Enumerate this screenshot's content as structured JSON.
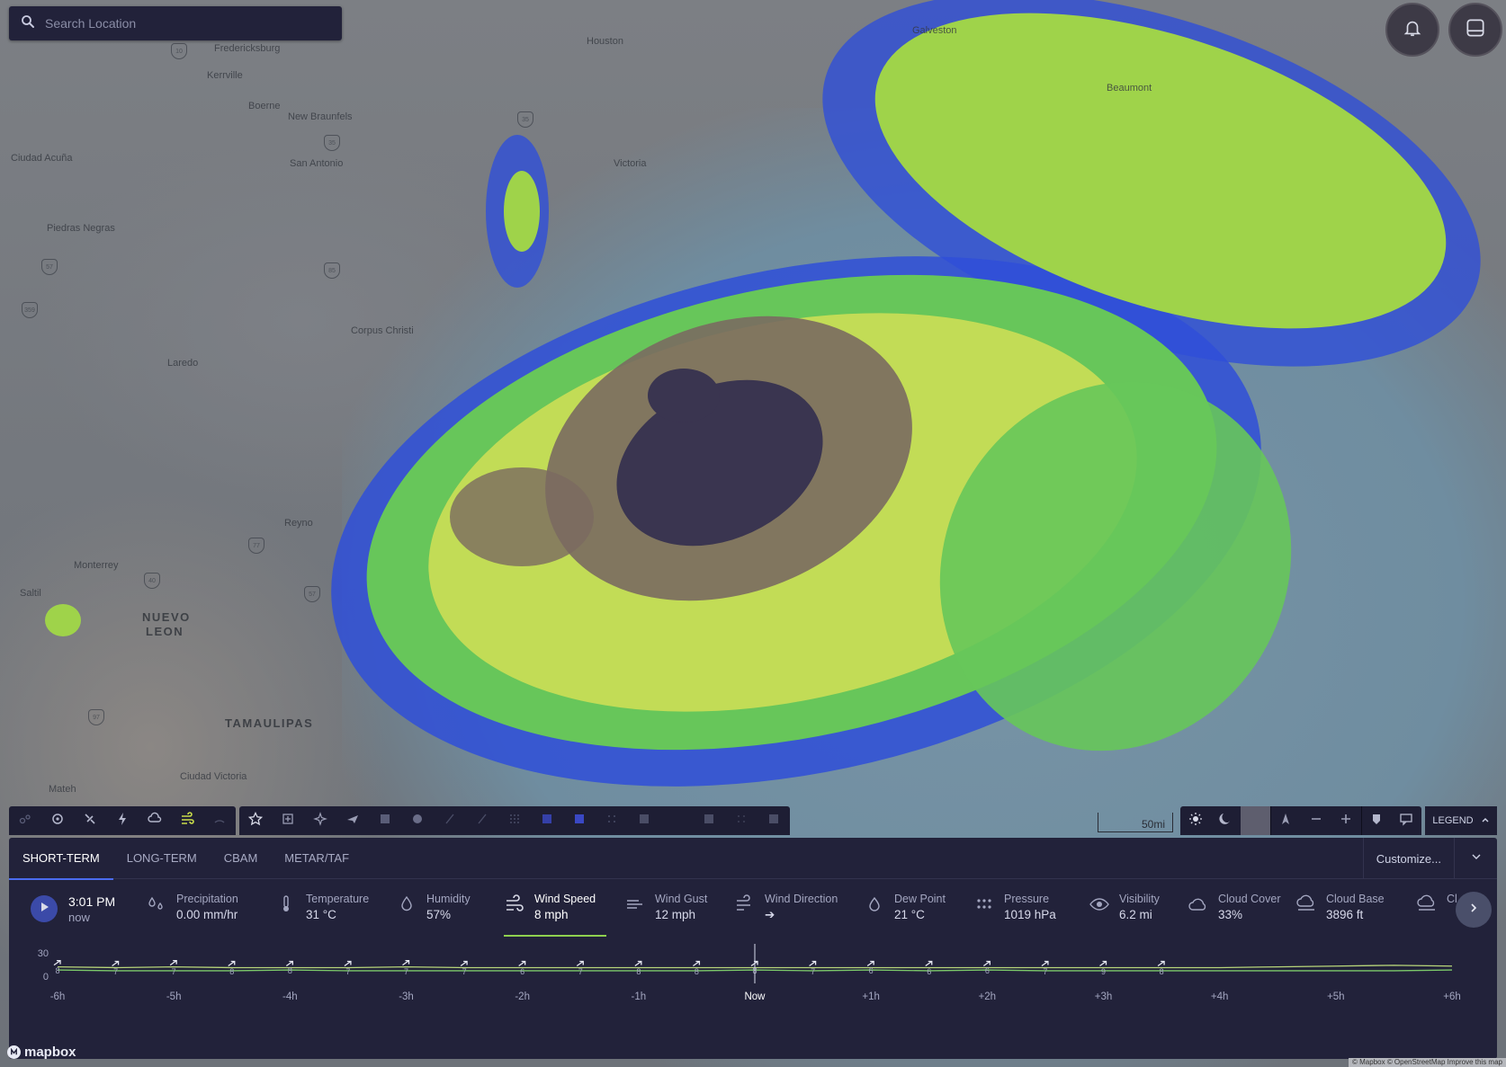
{
  "search": {
    "placeholder": "Search Location"
  },
  "map": {
    "labels": {
      "fredericksburg": "Fredericksburg",
      "kerrville": "Kerrville",
      "boerne": "Boerne",
      "new_braunfels": "New Braunfels",
      "san_antonio": "San Antonio",
      "ciudad_acuna": "Ciudad Acuña",
      "piedras_negras": "Piedras Negras",
      "laredo": "Laredo",
      "corpus_christi": "Corpus Christi",
      "reynosa": "Reyno",
      "monterrey": "Monterrey",
      "nuevo_leon_1": "NUEVO",
      "nuevo_leon_2": "LEON",
      "tamaulipas": "TAMAULIPAS",
      "ciudad_victoria": "Ciudad Victoria",
      "saltillo": "Saltil",
      "matehuala": "Mateh",
      "victoria_tx": "Victoria",
      "galveston": "Galveston",
      "beaumont": "Beaumont",
      "houston": "Houston"
    },
    "shields": [
      "10",
      "35",
      "35",
      "57",
      "359",
      "85",
      "40",
      "57",
      "97",
      "77"
    ],
    "scale_label": "50mi",
    "legend_label": "LEGEND",
    "attribution": "© Mapbox © OpenStreetMap  Improve this map",
    "logo_text": "mapbox"
  },
  "tabs": {
    "short_term": "SHORT-TERM",
    "long_term": "LONG-TERM",
    "cbam": "CBAM",
    "metar_taf": "METAR/TAF",
    "customize": "Customize..."
  },
  "current": {
    "time": "3:01 PM",
    "relative": "now"
  },
  "metrics": {
    "precipitation": {
      "label": "Precipitation",
      "value": "0.00 mm/hr"
    },
    "temperature": {
      "label": "Temperature",
      "value": "31 °C"
    },
    "humidity": {
      "label": "Humidity",
      "value": "57%"
    },
    "wind_speed": {
      "label": "Wind Speed",
      "value": "8 mph"
    },
    "wind_gust": {
      "label": "Wind Gust",
      "value": "12 mph"
    },
    "wind_direction": {
      "label": "Wind Direction",
      "value": "➔"
    },
    "dew_point": {
      "label": "Dew Point",
      "value": "21 °C"
    },
    "pressure": {
      "label": "Pressure",
      "value": "1019 hPa"
    },
    "visibility": {
      "label": "Visibility",
      "value": "6.2 mi"
    },
    "cloud_cover": {
      "label": "Cloud Cover",
      "value": "33%"
    },
    "cloud_base": {
      "label": "Cloud Base",
      "value": "3896 ft"
    },
    "cloud_ceiling": {
      "label": "Cl..."
    }
  },
  "chart_data": {
    "type": "line",
    "title": "",
    "ylim": [
      0,
      30
    ],
    "y_ticks": [
      "30",
      "0"
    ],
    "x": [
      "-6h",
      "",
      "-5h",
      "",
      "-4h",
      "",
      "-3h",
      "",
      "-2h",
      "",
      "-1h",
      "",
      "Now",
      "",
      "+1h",
      "",
      "+2h",
      "",
      "+3h",
      "",
      "+4h",
      "",
      "+5h",
      "",
      "+6h"
    ],
    "series": [
      {
        "values": [
          8,
          7,
          7,
          7,
          8,
          7,
          7,
          7,
          7,
          7,
          7,
          7,
          8,
          7,
          8,
          7,
          8,
          7,
          7,
          7,
          7,
          7,
          7,
          7,
          8
        ]
      },
      {
        "values": [
          12,
          11,
          12,
          11,
          11,
          11,
          12,
          11,
          11,
          11,
          11,
          11,
          11,
          11,
          11,
          11,
          11,
          11,
          11,
          11,
          11,
          12,
          13,
          14,
          13
        ]
      }
    ],
    "point_labels": [
      "8",
      "7",
      "7",
      "8",
      "8",
      "7",
      "7",
      "7",
      "6",
      "7",
      "8",
      "8",
      "8",
      "7",
      "6",
      "6",
      "6",
      "7",
      "9",
      "8"
    ],
    "colors": {
      "speed": "#7cc96a",
      "gust": "#b9d77a",
      "now_line": "#d7d9ea"
    }
  },
  "colors": {
    "accent": "#4b6cf0",
    "selected_underline": "#8fd14f",
    "panel_bg": "#22223a"
  }
}
